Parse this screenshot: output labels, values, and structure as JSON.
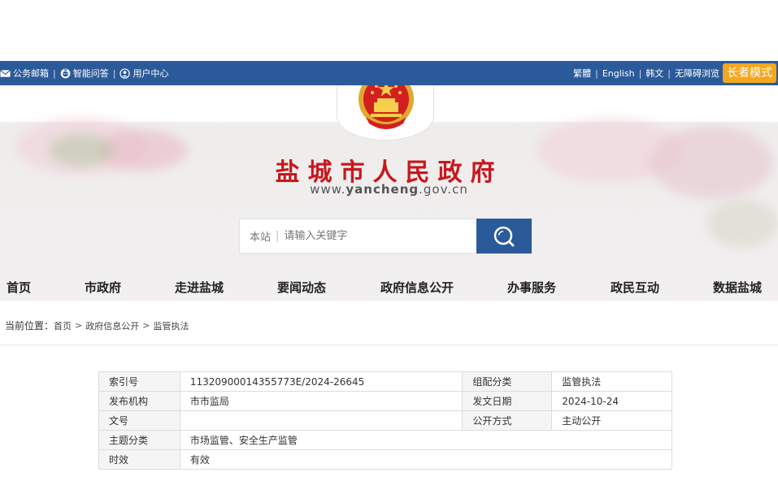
{
  "topbar": {
    "mail": "公务邮箱",
    "qa": "智能问答",
    "user_center": "用户中心",
    "traditional": "繁體",
    "english": "English",
    "korean": "韩文",
    "accessible": "无障碍浏览",
    "elder_mode": "长者模式",
    "separator": "|"
  },
  "header": {
    "title": "盐城市人民政府",
    "url_prefix": "www.",
    "url_bold": "yancheng",
    "url_suffix": ".gov.cn"
  },
  "search": {
    "scope": "本站",
    "divider": "|",
    "placeholder": "请输入关键字"
  },
  "nav": [
    {
      "label": "首页"
    },
    {
      "label": "市政府"
    },
    {
      "label": "走进盐城"
    },
    {
      "label": "要闻动态"
    },
    {
      "label": "政府信息公开"
    },
    {
      "label": "办事服务"
    },
    {
      "label": "政民互动"
    },
    {
      "label": "数据盐城"
    }
  ],
  "breadcrumb": {
    "label": "当前位置：",
    "items": [
      "首页",
      "政府信息公开",
      "监管执法"
    ],
    "sep": ">"
  },
  "meta": {
    "rows": [
      {
        "k1": "索引号",
        "v1": "11320900014355773E/2024-26645",
        "k2": "组配分类",
        "v2": "监管执法"
      },
      {
        "k1": "发布机构",
        "v1": "市市监局",
        "k2": "发文日期",
        "v2": "2024-10-24"
      },
      {
        "k1": "文号",
        "v1": "",
        "k2": "公开方式",
        "v2": "主动公开"
      },
      {
        "k1": "主题分类",
        "v1": "市场监管、安全生产监管"
      },
      {
        "k1": "时效",
        "v1": "有效"
      }
    ]
  },
  "colors": {
    "brand_blue": "#2b5a9a",
    "title_red": "#c8171d",
    "elder_orange": "#f2a81d"
  },
  "icons": {
    "mail": "mail-icon",
    "qa": "chat-robot-icon",
    "user": "user-icon",
    "search": "search-icon",
    "emblem": "national-emblem-icon"
  }
}
